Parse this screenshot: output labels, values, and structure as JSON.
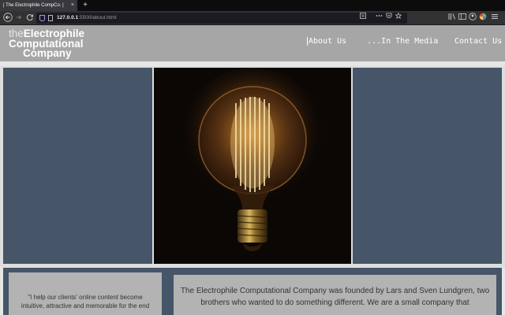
{
  "browser": {
    "tab_title": "| The Electrophile CompCo. |",
    "tab_close": "×",
    "new_tab": "+",
    "url_host": "127.0.0.1",
    "url_path": ":5500/about.html"
  },
  "site": {
    "logo": {
      "line1_small": "the",
      "line1": "Electrophile",
      "line2": "Computational",
      "line3": "Company"
    },
    "nav": [
      {
        "label": "About Us"
      },
      {
        "label": "...In The Media"
      },
      {
        "label": "Contact Us"
      }
    ]
  },
  "content": {
    "quote": "\"I help our clients' online content become intuitive, attractive and memorable for the end",
    "about": "The Electrophile Computational Company was founded by Lars and Sven Lundgren, two brothers who wanted to do something different. We are a small company that"
  },
  "colors": {
    "panel": "#465568",
    "header": "#a6a6a6",
    "box": "#b3b3b3"
  }
}
